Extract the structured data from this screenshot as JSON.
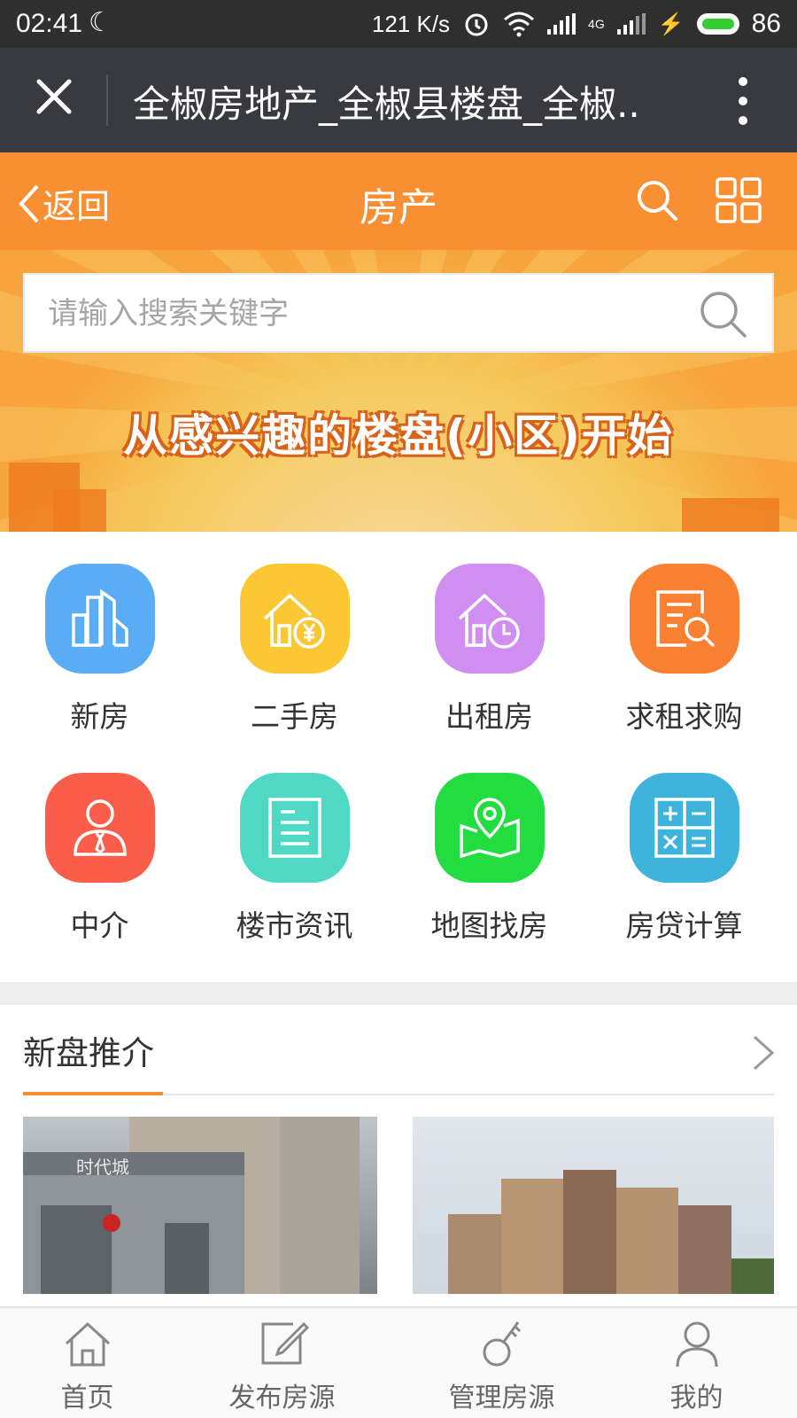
{
  "status_bar": {
    "time": "02:41",
    "net_speed": "121 K/s",
    "network": "4G",
    "battery": "86"
  },
  "wechat_bar": {
    "title": "全椒房地产_全椒县楼盘_全椒.."
  },
  "header": {
    "back_label": "返回",
    "title": "房产",
    "accent_color": "#f88f32"
  },
  "banner": {
    "search_placeholder": "请输入搜索关键字",
    "slogan": "从感兴趣的楼盘(小区)开始"
  },
  "categories": [
    {
      "label": "新房",
      "icon": "buildings-icon",
      "color": "#5aacf4"
    },
    {
      "label": "二手房",
      "icon": "house-yuan-icon",
      "color": "#fbc834"
    },
    {
      "label": "出租房",
      "icon": "house-clock-icon",
      "color": "#cf8ef0"
    },
    {
      "label": "求租求购",
      "icon": "document-search-icon",
      "color": "#fa8132"
    },
    {
      "label": "中介",
      "icon": "agent-icon",
      "color": "#fa5e4b"
    },
    {
      "label": "楼市资讯",
      "icon": "news-icon",
      "color": "#4fd9c4"
    },
    {
      "label": "地图找房",
      "icon": "map-pin-icon",
      "color": "#21dd3f"
    },
    {
      "label": "房贷计算",
      "icon": "calculator-icon",
      "color": "#3eb4dc"
    }
  ],
  "section": {
    "title": "新盘推介",
    "photo_sign_text": "时代城"
  },
  "tabbar": [
    {
      "label": "首页",
      "icon": "home-icon"
    },
    {
      "label": "发布房源",
      "icon": "edit-icon"
    },
    {
      "label": "管理房源",
      "icon": "key-icon"
    },
    {
      "label": "我的",
      "icon": "user-icon"
    }
  ]
}
